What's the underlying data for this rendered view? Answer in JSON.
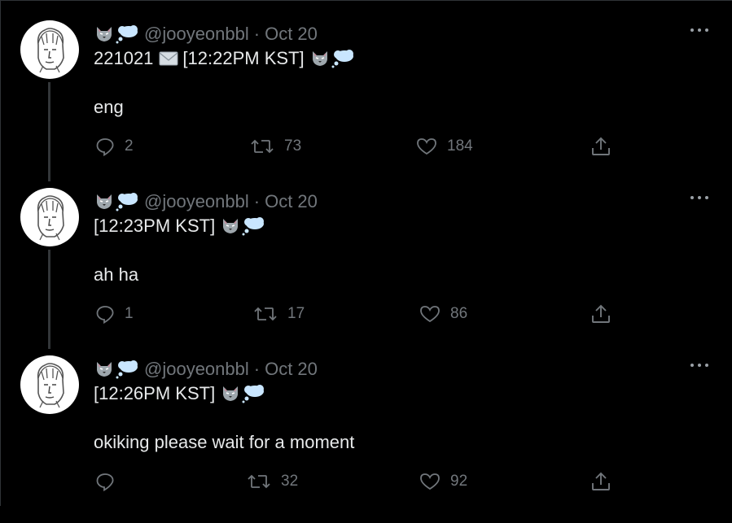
{
  "tweets": [
    {
      "handle": "@jooyeonbbl",
      "sep": "·",
      "date": "Oct 20",
      "line1_prefix": "221021",
      "line1_main": "[12:22PM KST]",
      "line2": "eng",
      "replies": "2",
      "retweets": "73",
      "likes": "184",
      "has_mail": true
    },
    {
      "handle": "@jooyeonbbl",
      "sep": "·",
      "date": "Oct 20",
      "line1_prefix": "",
      "line1_main": "[12:23PM KST]",
      "line2": "ah ha",
      "replies": "1",
      "retweets": "17",
      "likes": "86",
      "has_mail": false
    },
    {
      "handle": "@jooyeonbbl",
      "sep": "·",
      "date": "Oct 20",
      "line1_prefix": "",
      "line1_main": "[12:26PM KST]",
      "line2": "okiking please wait for a moment",
      "replies": "",
      "retweets": "32",
      "likes": "92",
      "has_mail": false
    }
  ],
  "icons": {
    "wolf": "wolf-emoji-icon",
    "bubble": "thought-balloon-emoji-icon",
    "mail": "envelope-emoji-icon",
    "reply": "reply-icon",
    "retweet": "retweet-icon",
    "like": "heart-icon",
    "share": "share-icon",
    "more": "more-icon"
  },
  "colors": {
    "background": "#000000",
    "text": "#e7e9ea",
    "muted": "#71767b",
    "thread_line": "#333639"
  }
}
